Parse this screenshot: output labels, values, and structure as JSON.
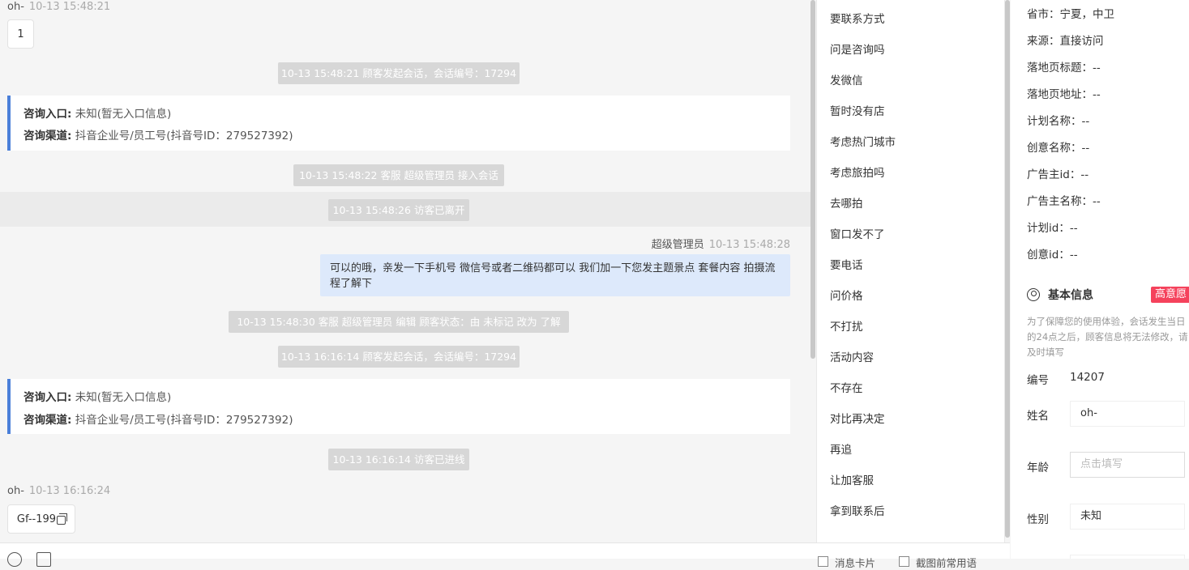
{
  "chat": {
    "msg1": {
      "sender": "oh-",
      "time": "10-13 15:48:21",
      "text": "1"
    },
    "sys1": "10-13 15:48:21 顾客发起会话，会话编号：17294",
    "card1": {
      "entry_key": "咨询入口:",
      "entry_val": "未知(暂无入口信息)",
      "channel_key": "咨询渠道:",
      "channel_val": "抖音企业号/员工号(抖音号ID：279527392)"
    },
    "sys2": "10-13 15:48:22 客服 超级管理员 接入会话",
    "sys3": "10-13 15:48:26 访客已离开",
    "agent_msg": {
      "sender": "超级管理员",
      "time": "10-13 15:48:28",
      "text": "可以的哦，亲发一下手机号 微信号或者二维码都可以 我们加一下您发主题景点 套餐内容 拍摄流程了解下"
    },
    "sys4": "10-13 15:48:30 客服 超级管理员 编辑 顾客状态：由 未标记 改为 了解",
    "sys5": "10-13 16:16:14 顾客发起会话，会话编号：17294",
    "card2": {
      "entry_key": "咨询入口:",
      "entry_val": "未知(暂无入口信息)",
      "channel_key": "咨询渠道:",
      "channel_val": "抖音企业号/员工号(抖音号ID：279527392)"
    },
    "sys6": "10-13 16:16:14 访客已进线",
    "msg2": {
      "sender": "oh-",
      "time": "10-13 16:16:24",
      "text": "Gf--199"
    }
  },
  "toolbar": {
    "emoji_icon": "emoji-icon",
    "image_icon": "image-icon",
    "check1_label": "消息卡片",
    "check2_label": "截图前常用语"
  },
  "quick_replies": [
    "要联系方式",
    "问是咨询吗",
    "发微信",
    "暂时没有店",
    "考虑热门城市",
    "考虑旅拍吗",
    "去哪拍",
    "窗口发不了",
    "要电话",
    "问价格",
    "不打扰",
    "活动内容",
    "不存在",
    "对比再决定",
    "再追",
    "让加客服",
    "拿到联系后"
  ],
  "info": {
    "province": "省市：宁夏，中卫",
    "source": "来源：直接访问",
    "landing_title": "落地页标题：--",
    "landing_url": "落地页地址：--",
    "plan_name": "计划名称：--",
    "creative_name": "创意名称：--",
    "advertiser_id": "广告主id：--",
    "advertiser_name": "广告主名称：--",
    "plan_id": "计划id：--",
    "creative_id": "创意id：--",
    "section_title": "基本信息",
    "badge": "高意愿",
    "notice": "为了保障您的使用体验，会话发生当日的24点之后，顾客信息将无法修改，请及时填写",
    "id_label": "编号",
    "id_value": "14207",
    "name_label": "姓名",
    "name_value": "oh-",
    "age_label": "年龄",
    "age_placeholder": "点击填写",
    "gender_label": "性别",
    "gender_value": "未知"
  },
  "colors": {
    "accent": "#4a7fd9",
    "badge": "#f5425c",
    "agent_bubble": "#dde9fb",
    "system": "#d7d7d7"
  }
}
